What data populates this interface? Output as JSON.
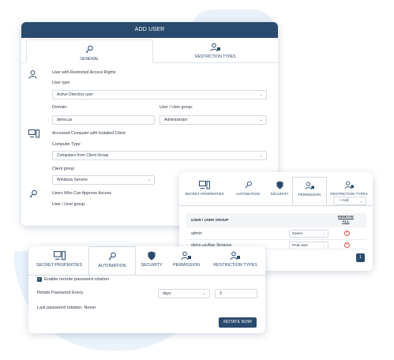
{
  "add_user": {
    "title": "ADD USER",
    "tabs": [
      {
        "label": "GENERAL",
        "icon": "key-icon"
      },
      {
        "label": "RESTRICTION TYPES",
        "icon": "user-lock-icon"
      }
    ],
    "section_user": {
      "title": "User with Restricted Access Rights"
    },
    "user_type": {
      "label": "User type:",
      "value": "Active Directory user"
    },
    "domain": {
      "label": "Domain:",
      "value": "demo.us"
    },
    "user_group": {
      "label": "User / User group:",
      "value": "Administrator"
    },
    "section_computer": {
      "title": "Accessed Computer with Installed Client"
    },
    "computer_type": {
      "label": "Computer Type:",
      "value": "Computers from Client Group"
    },
    "client_group": {
      "label": "Client group",
      "value": "Windows Servers"
    },
    "section_approve": {
      "title": "Users Who Can Approve Access"
    },
    "approve_group": {
      "label": "User / User group:"
    }
  },
  "permission_panel": {
    "tabs": [
      "SECRET PROPERTIES",
      "AUTOMATION",
      "SECURITY",
      "PERMISSION",
      "RESTRICTION TYPES"
    ],
    "add_label": "+ Add",
    "columns": {
      "user": "USER / USER GROUP",
      "remove": "REMOVE ALL"
    },
    "rows": [
      {
        "user": "admin",
        "role": "Owner"
      },
      {
        "user": "demo.us\\Alan Simpson",
        "role": "PAM User"
      }
    ],
    "page": "1"
  },
  "automation_panel": {
    "tabs": [
      "SECRET PROPERTIES",
      "AUTOMATION",
      "SECURITY",
      "PERMISSION",
      "RESTRICTION TYPES"
    ],
    "enable_label": "Enable remote password rotation",
    "rotate_label": "Rotate Password Every",
    "unit_value": "days",
    "count_value": "3",
    "last_rotation": "Last password rotation: Never",
    "rotate_button": "ROTATE NOW"
  },
  "colors": {
    "primary": "#2a4b6e",
    "blob": "#e9f1fb",
    "danger": "#e05050"
  }
}
